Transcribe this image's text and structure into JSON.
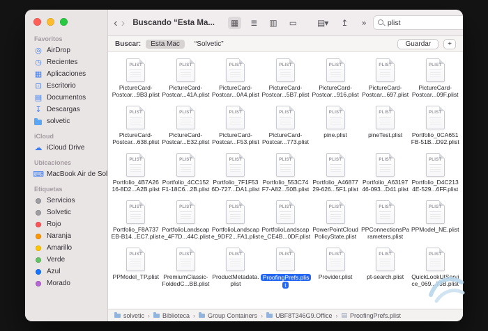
{
  "window_controls": [
    {
      "name": "close-button",
      "color": "#ff5f57"
    },
    {
      "name": "minimize-button",
      "color": "#febc2e"
    },
    {
      "name": "zoom-button",
      "color": "#28c840"
    }
  ],
  "toolbar": {
    "back_icon": "‹",
    "forward_icon": "›",
    "title": "Buscando “Esta Ma...",
    "view_modes": [
      {
        "icon": "grid-view-icon",
        "active": true
      },
      {
        "icon": "list-view-icon",
        "active": false
      },
      {
        "icon": "columns-view-icon",
        "active": false
      },
      {
        "icon": "gallery-view-icon",
        "active": false
      }
    ],
    "actions": [
      {
        "icon": "group-icon"
      },
      {
        "icon": "share-icon"
      },
      {
        "icon": "overflow-chevron-icon"
      }
    ],
    "search": {
      "value": "plist"
    }
  },
  "scope_bar": {
    "label": "Buscar:",
    "scopes": [
      {
        "label": "Esta Mac",
        "selected": true
      },
      {
        "label": "“Solvetic”",
        "selected": false
      }
    ],
    "save_button": "Guardar",
    "add_button": "+"
  },
  "sidebar": {
    "sections": [
      {
        "title": "Favoritos",
        "items": [
          {
            "label": "AirDrop",
            "icon": "airdrop-icon"
          },
          {
            "label": "Recientes",
            "icon": "clock-icon"
          },
          {
            "label": "Aplicaciones",
            "icon": "applications-icon"
          },
          {
            "label": "Escritorio",
            "icon": "desktop-icon"
          },
          {
            "label": "Documentos",
            "icon": "documents-icon"
          },
          {
            "label": "Descargas",
            "icon": "downloads-icon"
          },
          {
            "label": "solvetic",
            "icon": "folder-icon"
          }
        ]
      },
      {
        "title": "iCloud",
        "items": [
          {
            "label": "iCloud Drive",
            "icon": "icloud-icon"
          }
        ]
      },
      {
        "title": "Ubicaciones",
        "items": [
          {
            "label": "MacBook Air de Sol...",
            "icon": "laptop-icon"
          }
        ]
      },
      {
        "title": "Etiquetas",
        "items": [
          {
            "label": "Servicios",
            "icon": "tag-icon",
            "color": "#9e9ea3"
          },
          {
            "label": "Solvetic",
            "icon": "tag-icon",
            "color": "#9e9ea3"
          },
          {
            "label": "Rojo",
            "icon": "tag-icon",
            "color": "#ff5257"
          },
          {
            "label": "Naranja",
            "icon": "tag-icon",
            "color": "#ff9502"
          },
          {
            "label": "Amarillo",
            "icon": "tag-icon",
            "color": "#ffc600"
          },
          {
            "label": "Verde",
            "icon": "tag-icon",
            "color": "#65c466"
          },
          {
            "label": "Azul",
            "icon": "tag-icon",
            "color": "#1673ff"
          },
          {
            "label": "Morado",
            "icon": "tag-icon",
            "color": "#b667d6"
          }
        ]
      }
    ]
  },
  "file_badge": "PLIST",
  "files": [
    {
      "lines": [
        "PictureCard-",
        "Postcar...9B3.plist"
      ]
    },
    {
      "lines": [
        "PictureCard-",
        "Postcar...41A.plist"
      ]
    },
    {
      "lines": [
        "PictureCard-",
        "Postcar...0A4.plist"
      ]
    },
    {
      "lines": [
        "PictureCard-",
        "Postcar...5B7.plist"
      ]
    },
    {
      "lines": [
        "PictureCard-",
        "Postcar...916.plist"
      ]
    },
    {
      "lines": [
        "PictureCard-",
        "Postcar...697.plist"
      ]
    },
    {
      "lines": [
        "PictureCard-",
        "Postcar...09F.plist"
      ]
    },
    {
      "lines": [
        "PictureCard-",
        "Postcar...638.plist"
      ]
    },
    {
      "lines": [
        "PictureCard-",
        "Postcar...E32.plist"
      ]
    },
    {
      "lines": [
        "PictureCard-",
        "Postcar...F53.plist"
      ]
    },
    {
      "lines": [
        "PictureCard-",
        "Postcar...773.plist"
      ]
    },
    {
      "lines": [
        "pine.plist"
      ]
    },
    {
      "lines": [
        "pineTest.plist"
      ]
    },
    {
      "lines": [
        "Portfolio_0CA651",
        "FB-51B...D92.plist"
      ]
    },
    {
      "lines": [
        "Portfolio_4B7A26",
        "16-8D2...A2B.plist"
      ]
    },
    {
      "lines": [
        "Portfolio_4CC152",
        "F1-18C6...2B.plist"
      ]
    },
    {
      "lines": [
        "Portfolio_7F1F53",
        "6D-727...DA1.plist"
      ]
    },
    {
      "lines": [
        "Portfolio_553C74",
        "F7-A82...50B.plist"
      ]
    },
    {
      "lines": [
        "Portfolio_A46877",
        "29-626...5F1.plist"
      ]
    },
    {
      "lines": [
        "Portfolio_A63197",
        "46-093...D41.plist"
      ]
    },
    {
      "lines": [
        "Portfolio_D4C213",
        "4E-529...6FF.plist"
      ]
    },
    {
      "lines": [
        "Portfolio_F8A737",
        "EB-B14...EC7.plist"
      ]
    },
    {
      "lines": [
        "PortfolioLandscap",
        "e_4F7D...44C.plist"
      ]
    },
    {
      "lines": [
        "PortfolioLandscap",
        "e_9DF2...FA1.plist"
      ]
    },
    {
      "lines": [
        "PortfolioLandscap",
        "e_CE4B...0DF.plist"
      ]
    },
    {
      "lines": [
        "PowerPointCloud",
        "PolicyState.plist"
      ]
    },
    {
      "lines": [
        "PPConnectionsPa",
        "rameters.plist"
      ]
    },
    {
      "lines": [
        "PPModel_NE.plist"
      ]
    },
    {
      "lines": [
        "PPModel_TP.plist"
      ]
    },
    {
      "lines": [
        "PremiumClassic-",
        "FoldedC...BB.plist"
      ]
    },
    {
      "lines": [
        "ProductMetadata.",
        "plist"
      ]
    },
    {
      "lines": [
        "ProofingPrefs.plis",
        "t"
      ],
      "selected": true
    },
    {
      "lines": [
        "Provider.plist"
      ]
    },
    {
      "lines": [
        "pt-search.plist"
      ]
    },
    {
      "lines": [
        "QuickLookUIServi",
        "ce_069...73B.plist"
      ]
    }
  ],
  "path_bar": {
    "items": [
      {
        "label": "solvetic",
        "icon": "folder-icon"
      },
      {
        "label": "Biblioteca",
        "icon": "folder-icon"
      },
      {
        "label": "Group Containers",
        "icon": "folder-icon"
      },
      {
        "label": "UBF8T346G9.Office",
        "icon": "folder-icon"
      },
      {
        "label": "ProofingPrefs.plist",
        "icon": "file-icon"
      }
    ]
  }
}
